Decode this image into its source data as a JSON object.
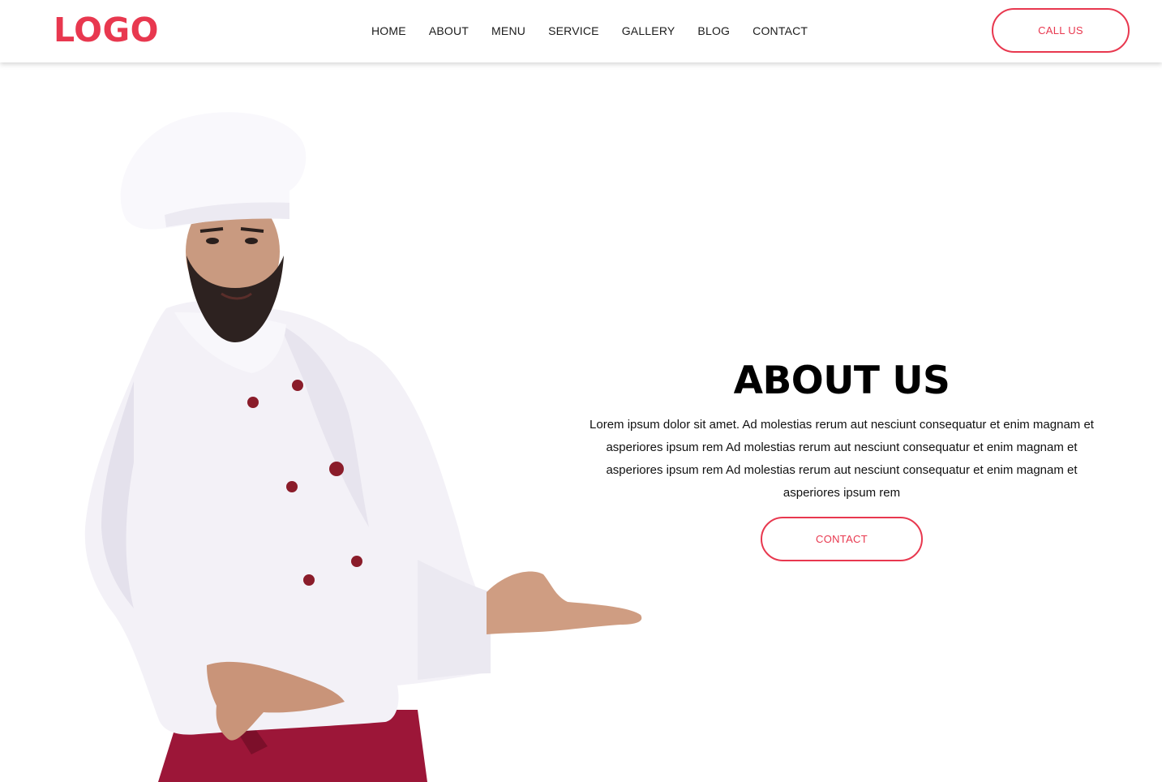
{
  "header": {
    "logo": "LOGO",
    "nav": [
      "HOME",
      "ABOUT",
      "MENU",
      "SERVICE",
      "GALLERY",
      "BLOG",
      "CONTACT"
    ],
    "call_label": "CALL US"
  },
  "about": {
    "title": "ABOUT US",
    "text": "Lorem ipsum dolor sit amet. Ad molestias rerum aut nesciunt consequatur et enim magnam et asperiores ipsum rem Ad molestias rerum aut nesciunt consequatur et enim magnam et asperiores ipsum rem Ad molestias rerum aut nesciunt consequatur et enim magnam et asperiores ipsum rem",
    "button_label": "CONTACT"
  },
  "colors": {
    "accent": "#e8384f",
    "apron": "#9c1638",
    "buttons": "#8a1c2a"
  },
  "image": {
    "subject": "chef-photo"
  }
}
